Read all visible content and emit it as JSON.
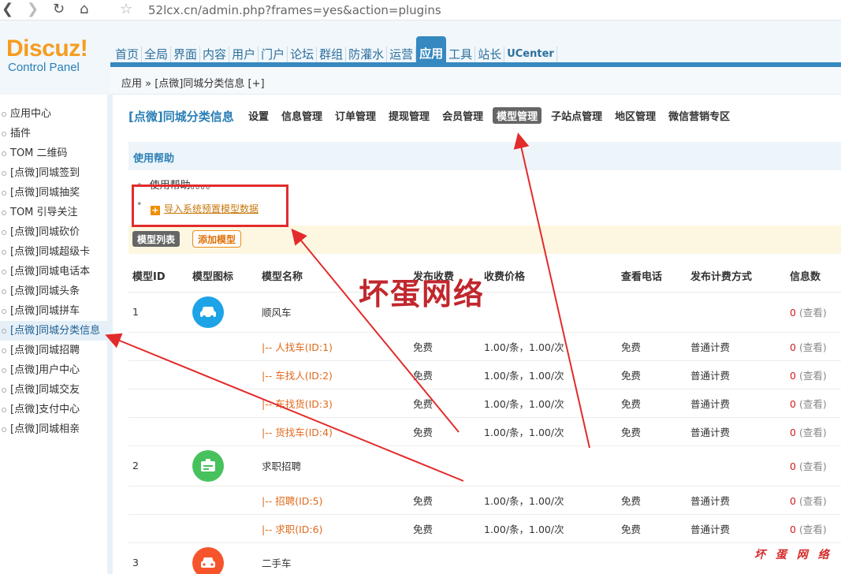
{
  "browser": {
    "url": "52lcx.cn/admin.php?frames=yes&action=plugins"
  },
  "logo": {
    "brand": "Discuz!",
    "sub": "Control Panel"
  },
  "topnav": [
    "首页",
    "全局",
    "界面",
    "内容",
    "用户",
    "门户",
    "论坛",
    "群组",
    "防灌水",
    "运营",
    "应用",
    "工具",
    "站长",
    "UCenter"
  ],
  "breadcrumb": "应用 » [点微]同城分类信息  [+]",
  "sidebar": [
    "应用中心",
    "插件",
    "TOM 二维码",
    "[点微]同城签到",
    "[点微]同城抽奖",
    "TOM 引导关注",
    "[点微]同城砍价",
    "[点微]同城超级卡",
    "[点微]同城电话本",
    "[点微]同城头条",
    "[点微]同城拼车",
    "[点微]同城分类信息",
    "[点微]同城招聘",
    "[点微]用户中心",
    "[点微]同城交友",
    "[点微]支付中心",
    "[点微]同城相亲"
  ],
  "page_title": "[点微]同城分类信息",
  "subtabs": [
    "设置",
    "信息管理",
    "订单管理",
    "提现管理",
    "会员管理",
    "模型管理",
    "子站点管理",
    "地区管理",
    "微信营销专区"
  ],
  "help": {
    "title": "使用帮助",
    "line1": "使用帮助。。。。",
    "import": "导入系统预置模型数据"
  },
  "buttons": {
    "list": "模型列表",
    "add": "添加模型"
  },
  "table": {
    "headers": [
      "模型ID",
      "模型图标",
      "模型名称",
      "发布收费",
      "收费价格",
      "查看电话",
      "发布计费方式",
      "信息数"
    ],
    "rows": [
      {
        "id": "1",
        "name": "顺风车",
        "count": "0",
        "view": "(查看)"
      },
      {
        "name": "|-- 人找车(ID:1)",
        "fee": "免费",
        "price": "1.00/条，1.00/次",
        "phone": "免费",
        "bill": "普通计费",
        "count": "0",
        "view": "(查看)"
      },
      {
        "name": "|-- 车找人(ID:2)",
        "fee": "免费",
        "price": "1.00/条，1.00/次",
        "phone": "免费",
        "bill": "普通计费",
        "count": "0",
        "view": "(查看)"
      },
      {
        "name": "|-- 车找货(ID:3)",
        "fee": "免费",
        "price": "1.00/条，1.00/次",
        "phone": "免费",
        "bill": "普通计费",
        "count": "0",
        "view": "(查看)"
      },
      {
        "name": "|-- 货找车(ID:4)",
        "fee": "免费",
        "price": "1.00/条，1.00/次",
        "phone": "免费",
        "bill": "普通计费",
        "count": "0",
        "view": "(查看)"
      },
      {
        "id": "2",
        "name": "求职招聘",
        "count": "0",
        "view": "(查看)"
      },
      {
        "name": "|-- 招聘(ID:5)",
        "fee": "免费",
        "price": "1.00/条，1.00/次",
        "phone": "免费",
        "bill": "普通计费",
        "count": "0",
        "view": "(查看)"
      },
      {
        "name": "|-- 求职(ID:6)",
        "fee": "免费",
        "price": "1.00/条，1.00/次",
        "phone": "免费",
        "bill": "普通计费",
        "count": "0",
        "view": "(查看)"
      },
      {
        "id": "3",
        "name": "二手车"
      }
    ]
  },
  "watermark": {
    "large": "坏蛋网络",
    "small": "坏 蛋 网 络"
  },
  "colors": {
    "accent": "#3688c0",
    "annotation": "#e32b2b",
    "logo_orange": "#f69c1f"
  }
}
